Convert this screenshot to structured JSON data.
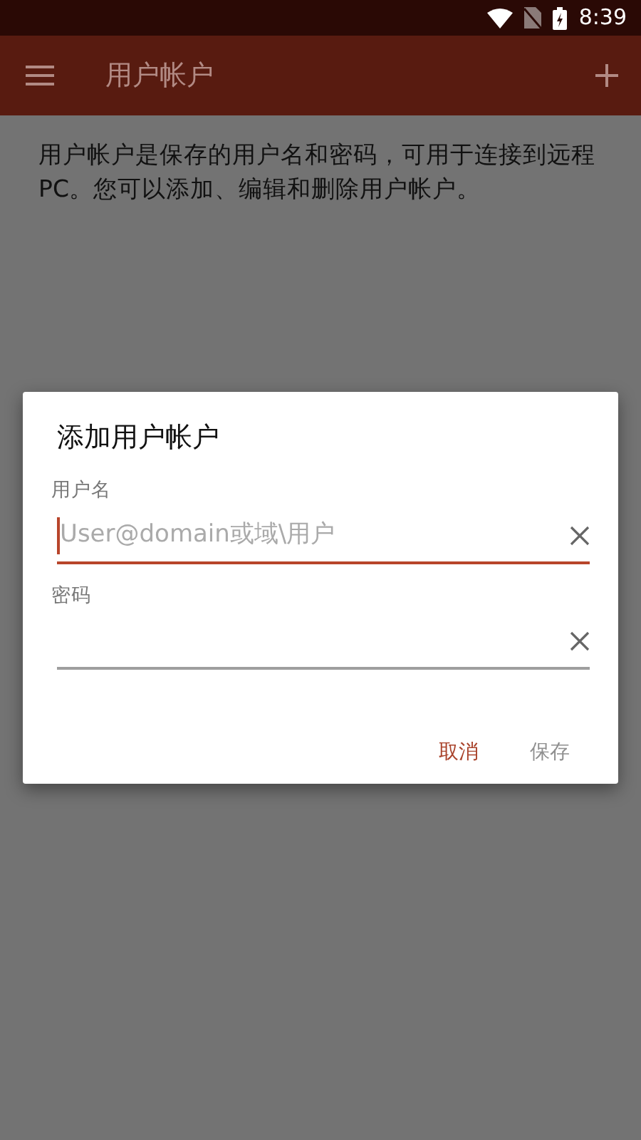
{
  "status_bar": {
    "time": "8:39"
  },
  "app_bar": {
    "title": "用户帐户"
  },
  "description": "用户帐户是保存的用户名和密码，可用于连接到远程PC。您可以添加、编辑和删除用户帐户。",
  "dialog": {
    "title": "添加用户帐户",
    "fields": [
      {
        "label": "用户名",
        "placeholder": "User@domain或域\\用户",
        "focused": true
      },
      {
        "label": "密码",
        "focused": false
      }
    ],
    "buttons": [
      {
        "label": "取消",
        "disabled": false
      },
      {
        "label": "保存",
        "disabled": true
      }
    ]
  }
}
